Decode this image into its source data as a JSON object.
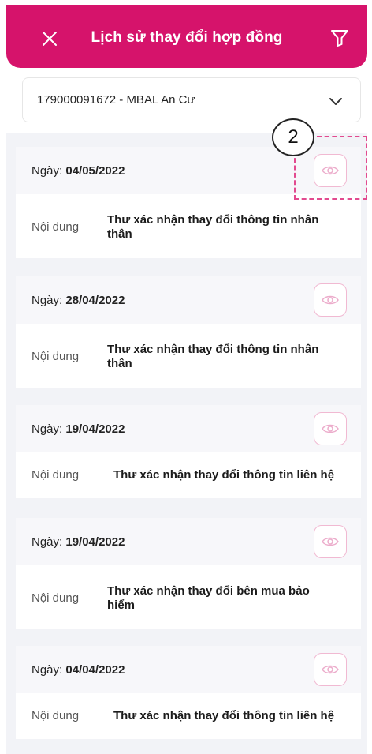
{
  "header": {
    "title": "Lịch sử thay đổi hợp đồng",
    "close_icon": "close-icon",
    "filter_icon": "filter-icon",
    "bg_color": "#d6136b"
  },
  "contract_select": {
    "value": "179000091672 - MBAL An Cư",
    "chevron_icon": "chevron-down-icon"
  },
  "history": [
    {
      "date_label": "Ngày:",
      "date": "04/05/2022",
      "content_label": "Nội dung",
      "content": "Thư xác nhận thay đổi thông tin nhân thân"
    },
    {
      "date_label": "Ngày:",
      "date": "28/04/2022",
      "content_label": "Nội dung",
      "content": "Thư xác nhận thay đổi thông tin nhân thân"
    },
    {
      "date_label": "Ngày:",
      "date": "19/04/2022",
      "content_label": "Nội dung",
      "content": "Thư xác nhận thay đổi thông tin liên hệ"
    },
    {
      "date_label": "Ngày:",
      "date": "19/04/2022",
      "content_label": "Nội dung",
      "content": "Thư xác nhận thay đổi bên mua bảo hiểm"
    },
    {
      "date_label": "Ngày:",
      "date": "04/04/2022",
      "content_label": "Nội dung",
      "content": "Thư xác nhận thay đổi thông tin liên hệ"
    }
  ],
  "annotation": {
    "number": "2",
    "color": "#e24a8f"
  }
}
